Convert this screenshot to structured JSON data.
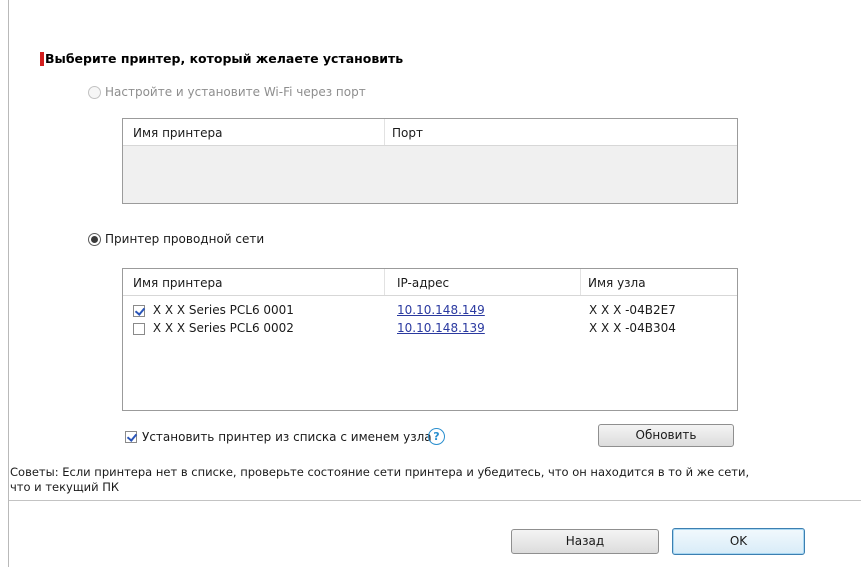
{
  "dialog": {
    "heading": "Выберите принтер, который желаете установить",
    "accent_color": "#d21f1f"
  },
  "wifi": {
    "radio_label": "Настройте и установите Wi-Fi через порт",
    "table": {
      "col_printer": "Имя принтера",
      "col_port": "Порт"
    }
  },
  "wired": {
    "radio_label": "Принтер проводной сети",
    "table": {
      "col_printer": "Имя принтера",
      "col_ip": "IP-адрес",
      "col_host": "Имя узла",
      "rows": [
        {
          "checked": true,
          "name": "X X X Series PCL6 0001",
          "ip": "10.10.148.149",
          "host": "X X X -04B2E7"
        },
        {
          "checked": false,
          "name": "X X X Series PCL6 0002",
          "ip": "10.10.148.139",
          "host": "X X X -04B304"
        }
      ]
    },
    "install_by_host_label": "Установить принтер из списка с именем узла",
    "help_icon": "?",
    "refresh_button": "Обновить"
  },
  "tips": "Советы: Если принтера нет в списке, проверьте состояние сети принтера и убедитесь, что он находится в то й же сети, что и текущий ПК",
  "footer": {
    "back_button": "Назад",
    "ok_button": "OK"
  }
}
